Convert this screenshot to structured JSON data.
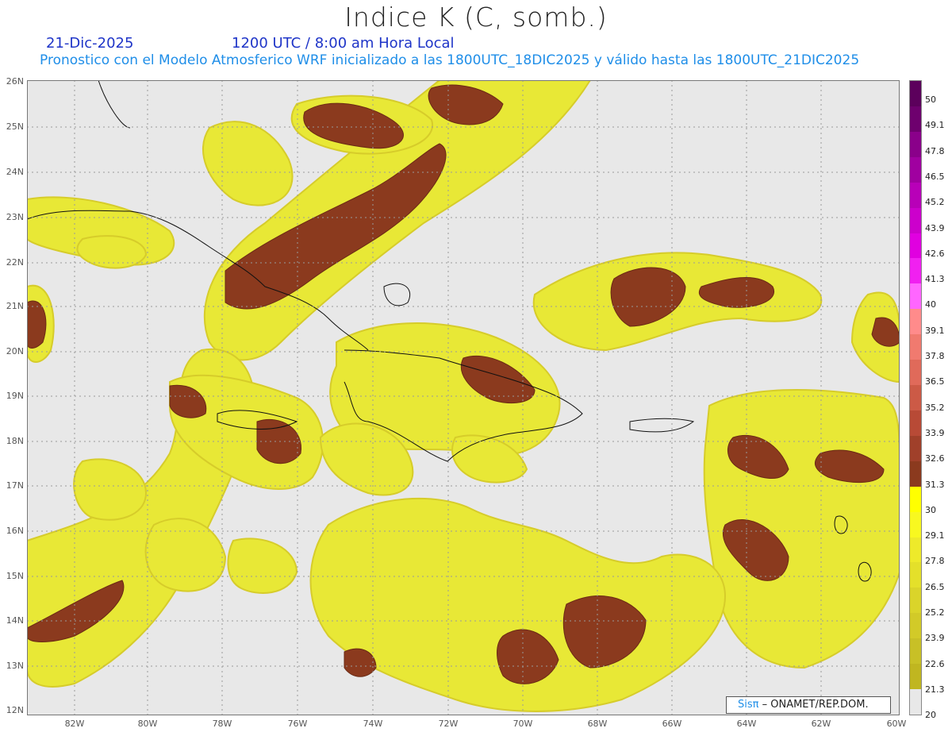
{
  "header": {
    "title": "Indice K (C, somb.)",
    "date": "21-Dic-2025",
    "valid_time": "1200 UTC / 8:00 am Hora Local",
    "subtitle": "Pronostico con el Modelo Atmosferico WRF inicializado a las 1800UTC_18DIC2025 y válido hasta las  1800UTC_21DIC2025"
  },
  "map": {
    "lat_labels": [
      "26N",
      "25N",
      "24N",
      "23N",
      "22N",
      "21N",
      "20N",
      "19N",
      "18N",
      "17N",
      "16N",
      "15N",
      "14N",
      "13N",
      "12N"
    ],
    "lon_labels": [
      "82W",
      "80W",
      "78W",
      "76W",
      "74W",
      "72W",
      "70W",
      "68W",
      "66W",
      "64W",
      "62W",
      "60W"
    ],
    "colors": {
      "background": "#e8e8e8",
      "yellow_light": "#f3f35a",
      "yellow": "#e8e836",
      "yellow_dark": "#d6cc2a",
      "brown": "#8b3a1e"
    }
  },
  "colorbar": {
    "labels": [
      "50",
      "49.1",
      "47.8",
      "46.5",
      "45.2",
      "43.9",
      "42.6",
      "41.3",
      "40",
      "39.1",
      "37.8",
      "36.5",
      "35.2",
      "33.9",
      "32.6",
      "31.3",
      "30",
      "29.1",
      "27.8",
      "26.5",
      "25.2",
      "23.9",
      "22.6",
      "21.3",
      "20"
    ],
    "colors": [
      "#5c005c",
      "#6e006e",
      "#8a008a",
      "#a000a0",
      "#b800b8",
      "#cc00cc",
      "#e000e0",
      "#f020f0",
      "#ff66ff",
      "#ff8b8b",
      "#f07a6f",
      "#e06a5a",
      "#cc5a46",
      "#b84a36",
      "#a0402a",
      "#8b3a1e",
      "#ffff00",
      "#f8f820",
      "#eeea2a",
      "#e4e02a",
      "#dad42a",
      "#d2ca28",
      "#c8c026",
      "#c0b620",
      "#e8e8e8"
    ]
  },
  "credit": {
    "sis": "Sisπ",
    "rest": " – ONAMET/REP.DOM."
  }
}
